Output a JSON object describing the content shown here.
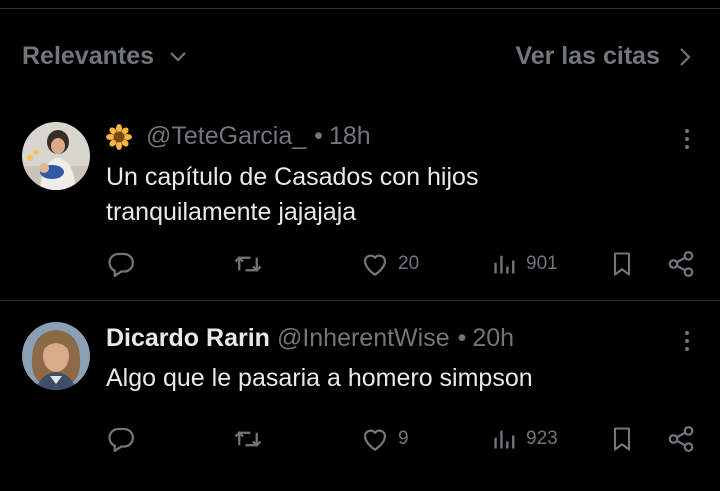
{
  "sort": {
    "label": "Relevantes",
    "quotes_label": "Ver las citas"
  },
  "tweets": [
    {
      "emoji": "🌻",
      "display_name": "",
      "handle": "@TeteGarcia_",
      "separator": "•",
      "time": "18h",
      "text_lines": [
        "Un capítulo de Casados con hijos",
        "tranquilamente jajajaja"
      ],
      "replies": "",
      "reposts": "",
      "likes": "20",
      "views": "901"
    },
    {
      "display_name": "Dicardo Rarin",
      "handle": "@InherentWise",
      "separator": "•",
      "time": "20h",
      "text_lines": [
        "Algo que le pasaria a homero simpson"
      ],
      "replies": "",
      "reposts": "",
      "likes": "9",
      "views": "923"
    }
  ],
  "colors": {
    "background": "#000000",
    "text": "#e7e9ea",
    "muted": "#71767b",
    "divider": "#2f3336"
  },
  "icons": [
    "chevron-down-icon",
    "chevron-right-icon",
    "more-icon",
    "reply-icon",
    "repost-icon",
    "like-icon",
    "views-icon",
    "bookmark-icon",
    "share-icon"
  ]
}
